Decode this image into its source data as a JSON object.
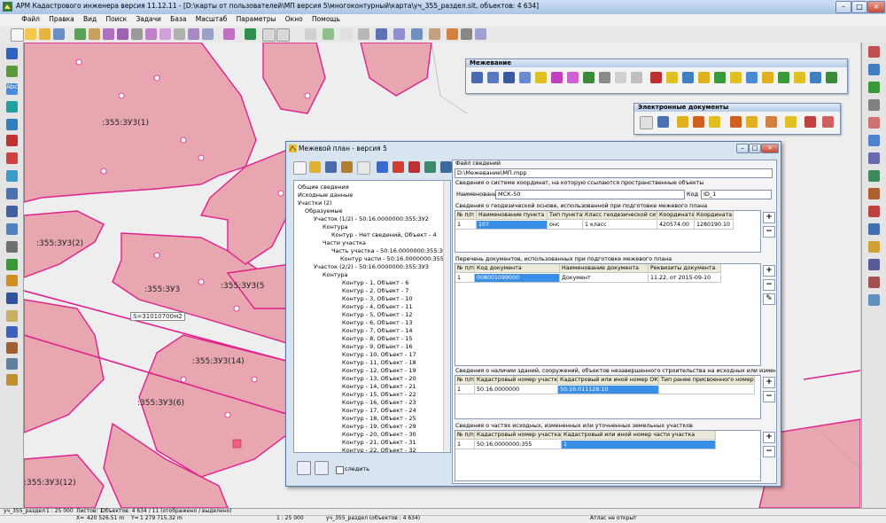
{
  "window": {
    "title": "АРМ Кадастрового инженера версия 11.12.11 - [D:\\карты от пользователей\\МП версия 5\\многоконтурный\\карта\\уч_355_раздел.sit, объектов: 4 634]"
  },
  "menu": [
    "Файл",
    "Правка",
    "Вид",
    "Поиск",
    "Задачи",
    "База",
    "Масштаб",
    "Параметры",
    "Окно",
    "Помощь"
  ],
  "palettes": {
    "mezhevanie": "Межевание",
    "electronic_docs": "Электронные документы"
  },
  "map_labels": {
    "zu1": ":355:ЗУ3(1)",
    "zu2": ":355:ЗУ3(2)",
    "zu3": ":355:ЗУ3",
    "zu5": ":355:ЗУ3(5",
    "zu14": ":355:ЗУ3(14)",
    "zu6": ":355:ЗУ3(6)",
    "zu12": ":355:ЗУ3(12)",
    "area": "S=31010700м2"
  },
  "dialog": {
    "title": "Межевой план - версия 5",
    "follow_label": "следить",
    "tree": {
      "general": "Общие сведения",
      "source": "Исходные данные",
      "plots": "Участки (2)",
      "formed": "Образуемые",
      "plot1": "Участок (1/2) - 50:16.0000000:355:ЗУ2",
      "contours": "Контура",
      "contour_none": "Контур - Нет сведений, Объект - 4",
      "parts": "Части участка",
      "part": "Часть участка - 50:16.0000000:355:ЗУ2",
      "part_contour": "Контур части - 50:16.0000000:355:ЗУ2",
      "plot2": "Участок (2/2) - 50:16.0000000:355:ЗУ3",
      "contours2": "Контура",
      "contour_items": [
        "Контур - 1, Объект - 6",
        "Контур - 2, Объект - 7",
        "Контур - 3, Объект - 10",
        "Контур - 4, Объект - 11",
        "Контур - 5, Объект - 12",
        "Контур - 6, Объект - 13",
        "Контур - 7, Объект - 14",
        "Контур - 8, Объект - 15",
        "Контур - 9, Объект - 16",
        "Контур - 10, Объект - 17",
        "Контур - 11, Объект - 18",
        "Контур - 12, Объект - 19",
        "Контур - 13, Объект - 20",
        "Контур - 14, Объект - 21",
        "Контур - 15, Объект - 22",
        "Контур - 16, Объект - 23",
        "Контур - 17, Объект - 24",
        "Контур - 18, Объект - 25",
        "Контур - 19, Объект - 29",
        "Контур - 20, Объект - 30",
        "Контур - 21, Объект - 31",
        "Контур - 22, Объект - 32"
      ]
    },
    "file": {
      "header": "Файл сведений",
      "path": "D:\\Межевание\\МП.mpp"
    },
    "coords": {
      "header": "Сведения о системе координат, на которую ссылаются пространственные объекты",
      "name_label": "Наименование",
      "name_value": "МСК-50",
      "code_label": "Код",
      "code_value": "ID_1"
    },
    "geodetic": {
      "header": "Сведения о геодезической основе, использованной при подготовке межевого плана",
      "cols": [
        "№ п/п",
        "Наименование пункта",
        "Тип пункта",
        "Класс геодезической сети",
        "Координата X",
        "Координата Y"
      ],
      "rows": [
        [
          "1",
          "107",
          "онс",
          "1 класс",
          "420574.00",
          "1280190.10"
        ]
      ]
    },
    "documents": {
      "header": "Перечень документов, использованных при подготовке межевого плана",
      "cols": [
        "№ п/п",
        "Код документа",
        "Наименование документа",
        "Реквизиты документа"
      ],
      "rows": [
        [
          "1",
          "008001099000",
          "Документ",
          "11.22, от 2015-09-10"
        ]
      ]
    },
    "buildings": {
      "header": "Сведения о наличии зданий, сооружений, объектов незавершенного строительства на исходных или измененных ЗУ",
      "cols": [
        "№ п/п",
        "Кадастровый номер участка",
        "Кадастровый или иной номер ОКС",
        "Тип ранее присвоенного номера"
      ],
      "rows": [
        [
          "1",
          "50:16.0000000",
          "50:16:011128:10",
          ""
        ]
      ]
    },
    "parts": {
      "header": "Сведения о частях исходных, измененных или уточненных земельных участков",
      "cols": [
        "№ п/п",
        "Кадастровый номер участка",
        "Кадастровый или иной номер части участка"
      ],
      "rows": [
        [
          "1",
          "50:16.0000000:355",
          "1"
        ]
      ]
    }
  },
  "status": {
    "layer": "уч_355_раздел",
    "scale_text": "1 : 25 000",
    "sheets": "Листов: 1",
    "objects": "Объектов: 4 634 / 11 (отображено / выделено)",
    "x_label": "X=",
    "x_value": "420 526.51 m",
    "y_label": "Y=",
    "y_value": "1 279 715.32 m",
    "scale2": "1 : 25 000",
    "layer2": "уч_355_раздел  (объектов : 4 634)",
    "atlas": "Атлас не открыт"
  },
  "colors": {
    "parcel_fill": "#e8a7b0",
    "parcel_stroke": "#e0208c",
    "selection": "#3a8ee6"
  }
}
